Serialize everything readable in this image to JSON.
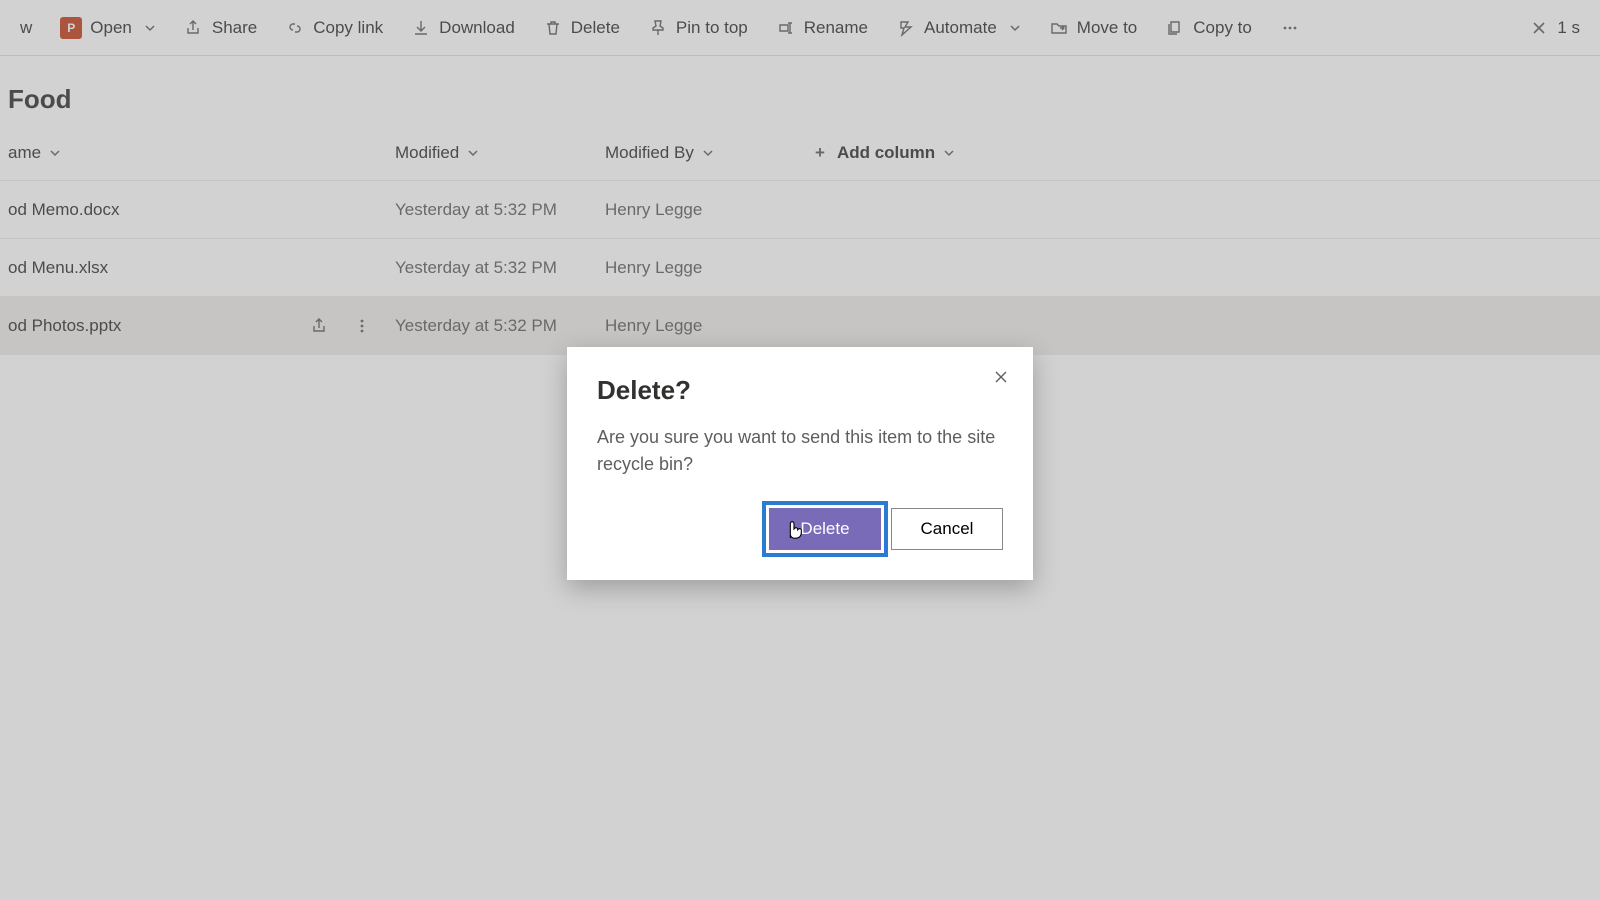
{
  "toolbar": {
    "new_fragment": "w",
    "open": "Open",
    "share": "Share",
    "copy_link": "Copy link",
    "download": "Download",
    "delete": "Delete",
    "pin": "Pin to top",
    "rename": "Rename",
    "automate": "Automate",
    "move_to": "Move to",
    "copy_to": "Copy to",
    "selection_fragment": "1 s"
  },
  "page": {
    "title_fragment": "Food"
  },
  "columns": {
    "name": "ame",
    "modified": "Modified",
    "modified_by": "Modified By",
    "add": "Add column"
  },
  "files": [
    {
      "name": "od Memo.docx",
      "modified": "Yesterday at 5:32 PM",
      "by": "Henry Legge",
      "selected": false
    },
    {
      "name": "od Menu.xlsx",
      "modified": "Yesterday at 5:32 PM",
      "by": "Henry Legge",
      "selected": false
    },
    {
      "name": "od Photos.pptx",
      "modified": "Yesterday at 5:32 PM",
      "by": "Henry Legge",
      "selected": true
    }
  ],
  "dialog": {
    "title": "Delete?",
    "message": "Are you sure you want to send this item to the site recycle bin?",
    "confirm": "Delete",
    "cancel": "Cancel"
  }
}
